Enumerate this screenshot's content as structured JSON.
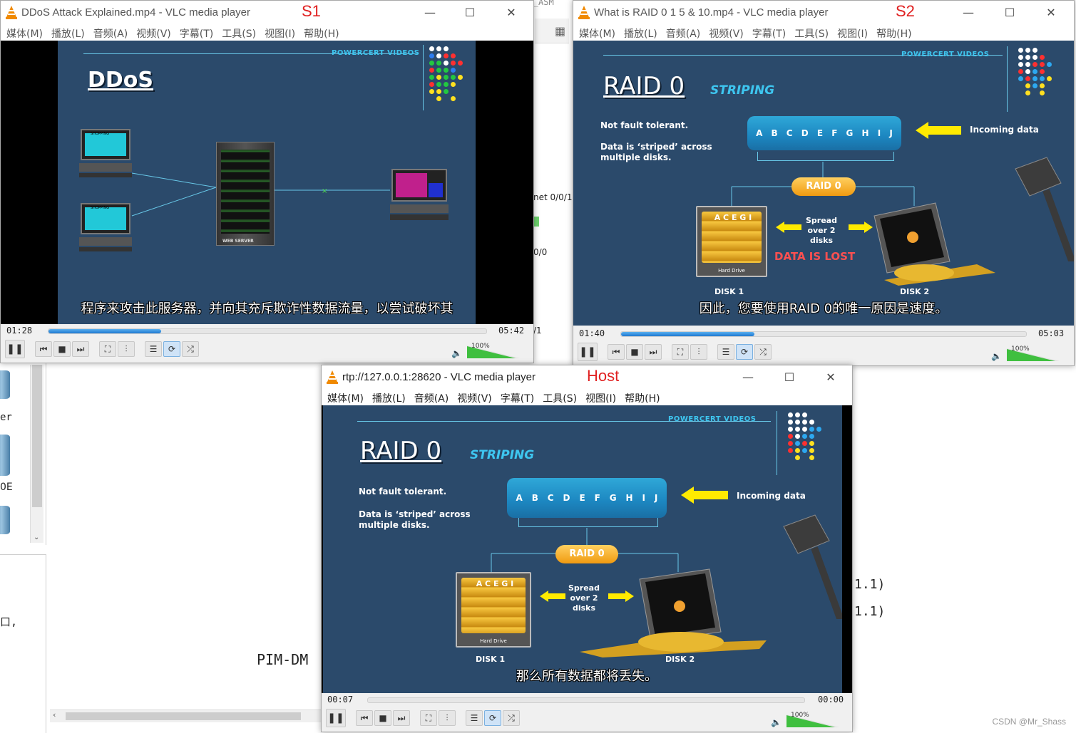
{
  "background": {
    "texts": {
      "net001": "net 0/0/1",
      "n00": "0/0",
      "n1": "/1",
      "pim": "PIM-DM",
      "ip1": "1.1)",
      "ip2": "1.1)",
      "er": "er",
      "oe": "0E",
      "comma": "口,",
      "top": "File-Cur_ASM"
    }
  },
  "s1": {
    "title": "DDoS Attack Explained.mp4 - VLC media player",
    "label": "S1",
    "menu": [
      "媒体(M)",
      "播放(L)",
      "音频(A)",
      "视频(V)",
      "字幕(T)",
      "工具(S)",
      "视图(I)",
      "帮助(H)"
    ],
    "slide": {
      "brand": "POWERCERT VIDEOS",
      "heading": "DDoS",
      "subtitle": "程序来攻击此服务器，并向其充斥欺诈性数据流量，以尝试破坏其",
      "shopping": "SHOPPING",
      "web_server": "WEB SERVER"
    },
    "time_elapsed": "01:28",
    "time_total": "05:42",
    "progress": 0.257,
    "volume": "100%"
  },
  "s2": {
    "title": "What is RAID 0 1 5 & 10.mp4 - VLC media player",
    "label": "S2",
    "menu": [
      "媒体(M)",
      "播放(L)",
      "音频(A)",
      "视频(V)",
      "字幕(T)",
      "工具(S)",
      "视图(I)",
      "帮助(H)"
    ],
    "slide": {
      "brand": "POWERCERT VIDEOS",
      "heading": "RAID 0",
      "sub": "STRIPING",
      "not_fault": "Not fault tolerant.",
      "striped": "Data is ‘striped’ across multiple disks.",
      "incoming": "Incoming data",
      "raid_pill": "RAID 0",
      "spread": "Spread over 2 disks",
      "lost": "DATA IS LOST",
      "disk1": "DISK 1",
      "disk2": "DISK 2",
      "hdd": "Hard Drive",
      "hdd_letters": "A C E G I",
      "drum_letters": [
        "A",
        "B",
        "C",
        "D",
        "E",
        "F",
        "G",
        "H",
        "I",
        "J"
      ],
      "subtitle": "因此，您要使用RAID 0的唯一原因是速度。"
    },
    "time_elapsed": "01:40",
    "time_total": "05:03",
    "progress": 0.33,
    "volume": "100%"
  },
  "host": {
    "title": "rtp://127.0.0.1:28620 - VLC media player",
    "label": "Host",
    "menu": [
      "媒体(M)",
      "播放(L)",
      "音频(A)",
      "视频(V)",
      "字幕(T)",
      "工具(S)",
      "视图(I)",
      "帮助(H)"
    ],
    "slide": {
      "brand": "POWERCERT VIDEOS",
      "heading": "RAID 0",
      "sub": "STRIPING",
      "not_fault": "Not fault tolerant.",
      "striped": "Data is ‘striped’ across multiple disks.",
      "incoming": "Incoming data",
      "raid_pill": "RAID 0",
      "spread": "Spread over 2 disks",
      "disk1": "DISK 1",
      "disk2": "DISK 2",
      "hdd": "Hard Drive",
      "hdd_letters": "A C E G I",
      "drum_letters": [
        "A",
        "B",
        "C",
        "D",
        "E",
        "F",
        "G",
        "H",
        "I",
        "J"
      ],
      "subtitle": "那么所有数据都将丢失。"
    },
    "time_elapsed": "00:07",
    "time_total": "00:00",
    "progress": 0.0,
    "volume": "100%"
  },
  "watermark": "CSDN @Mr_Shass",
  "colors": {
    "slide_bg": "#2b4a6b",
    "accent_cyan": "#3ec6f0",
    "label_red": "#e02020",
    "progress_blue": "#1e78d0",
    "volume_green": "#3fbf3f"
  }
}
